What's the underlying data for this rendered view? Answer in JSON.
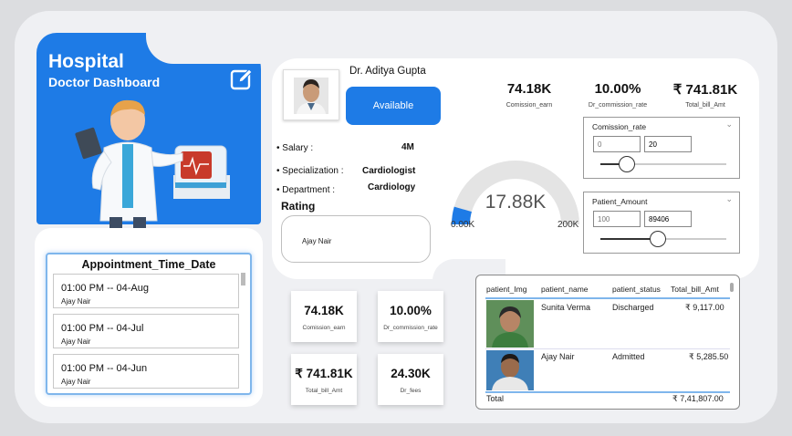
{
  "hero": {
    "title": "Hospital",
    "subtitle": "Doctor Dashboard",
    "edit_icon": "edit-icon"
  },
  "appointments": {
    "title": "Appointment_Time_Date",
    "items": [
      {
        "time": "01:00 PM -- 04-Aug",
        "name": "Ajay Nair"
      },
      {
        "time": "01:00 PM -- 04-Jul",
        "name": "Ajay Nair"
      },
      {
        "time": "01:00 PM -- 04-Jun",
        "name": "Ajay Nair"
      }
    ]
  },
  "doctor": {
    "name": "Dr. Aditya Gupta",
    "status": "Available",
    "salary_label": "• Salary :",
    "salary": "4M",
    "specialization_label": "• Specialization :",
    "specialization": "Cardiologist",
    "department_label": "• Department :",
    "department": "Cardiology",
    "rating_label": "Rating",
    "rating_value": "Ajay Nair"
  },
  "top_kpis": [
    {
      "value": "74.18K",
      "label": "Comission_earn"
    },
    {
      "value": "10.00%",
      "label": "Dr_commission_rate"
    },
    {
      "value": "₹ 741.81K",
      "label": "Total_bill_Amt"
    }
  ],
  "gauge": {
    "value": "17.88K",
    "min": "0.00K",
    "max": "200K",
    "fraction": 0.0894,
    "accent": "#1e7be6"
  },
  "slicers": {
    "commission": {
      "title": "Comission_rate",
      "min_placeholder": "0",
      "max_value": "20",
      "fraction": 0.21
    },
    "patient_amount": {
      "title": "Patient_Amount",
      "min_placeholder": "100",
      "max_value": "89406",
      "fraction": 0.46
    }
  },
  "bottom_kpis": [
    {
      "value": "74.18K",
      "label": "Comission_earn"
    },
    {
      "value": "10.00%",
      "label": "Dr_commission_rate"
    },
    {
      "value": "₹ 741.81K",
      "label": "Total_bill_Amt"
    },
    {
      "value": "24.30K",
      "label": "Dr_fees"
    }
  ],
  "table": {
    "columns": [
      "patient_Img",
      "patient_name",
      "patient_status",
      "Total_bill_Amt"
    ],
    "rows": [
      {
        "name": "Sunita Verma",
        "status": "Discharged",
        "amount": "₹ 9,117.00"
      },
      {
        "name": "Ajay Nair",
        "status": "Admitted",
        "amount": "₹ 5,285.50"
      }
    ],
    "total_label": "Total",
    "total_amount": "₹ 7,41,807.00"
  }
}
